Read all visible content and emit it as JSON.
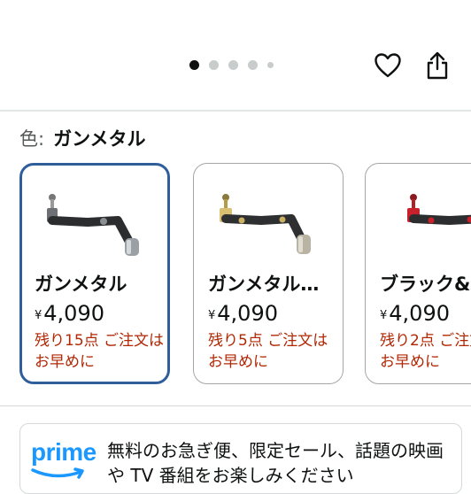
{
  "header": {
    "carousel": {
      "count": 5,
      "active_index": 0
    },
    "icons": [
      "heart-icon",
      "share-icon"
    ]
  },
  "color_selector": {
    "label": "色:",
    "selected_value": "ガンメタル"
  },
  "variants": [
    {
      "name": "ガンメタル",
      "currency": "¥",
      "price": "4,090",
      "stock": "残り15点 ご注文はお早めに",
      "selected": true,
      "accent": "#8a8f94"
    },
    {
      "name": "ガンメタル…",
      "currency": "¥",
      "price": "4,090",
      "stock": "残り5点 ご注文はお早めに",
      "selected": false,
      "accent": "#c9b062"
    },
    {
      "name": "ブラック&",
      "currency": "¥",
      "price": "4,090",
      "stock": "残り2点 ご注文はお早めに",
      "selected": false,
      "accent": "#c8212b"
    }
  ],
  "prime": {
    "logo_text": "prime",
    "message": "無料のお急ぎ便、限定セール、話題の映画や TV 番組をお楽しみください"
  },
  "colors": {
    "selected_border": "#2f5e9a",
    "stock_text": "#b12704",
    "prime_blue": "#1a98ff"
  }
}
